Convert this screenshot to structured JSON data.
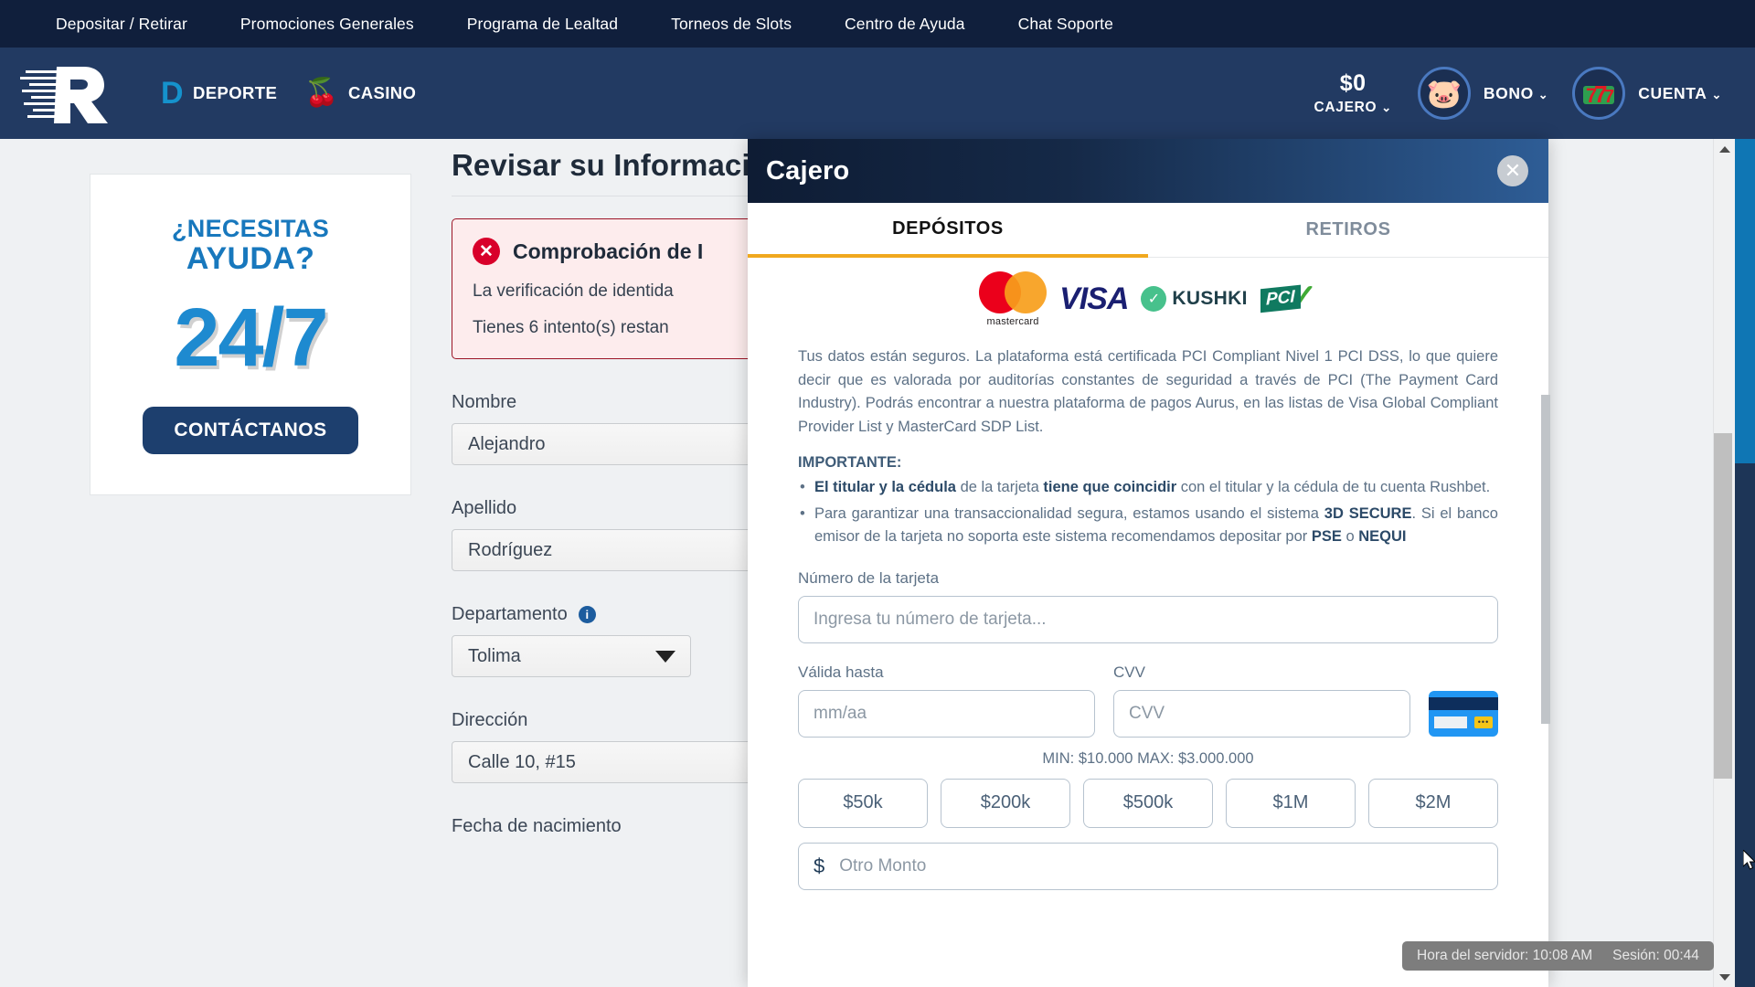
{
  "topnav": {
    "items": [
      {
        "label": "Depositar / Retirar"
      },
      {
        "label": "Promociones Generales"
      },
      {
        "label": "Programa de Lealtad"
      },
      {
        "label": "Torneos de Slots"
      },
      {
        "label": "Centro de Ayuda"
      },
      {
        "label": "Chat Soporte"
      }
    ]
  },
  "header": {
    "brand_logo": "rushbet-r-logo",
    "deporte": {
      "label": "DEPORTE",
      "badge": "D",
      "icon": "deporte-d-icon"
    },
    "casino": {
      "label": "CASINO",
      "icon": "cherries-icon"
    },
    "cajero": {
      "amount": "$0",
      "label": "CAJERO",
      "chevron": "chevron-down-icon"
    },
    "bono": {
      "label": "BONO",
      "icon": "piggy-bank-icon",
      "glyph": "🐷",
      "chevron": "chevron-down-icon"
    },
    "cuenta": {
      "label": "CUENTA",
      "icon": "slot-777-icon",
      "glyph": "7",
      "chevron": "chevron-down-icon"
    }
  },
  "promo": {
    "line1": "¿NECESITAS",
    "line2": "AYUDA?",
    "big": "24/7",
    "button": "CONTÁCTANOS"
  },
  "form": {
    "title": "Revisar su Información",
    "alert": {
      "icon": "error-circle-icon",
      "title": "Comprobación de I",
      "line1": "La verificación de identida",
      "line2": "Tienes 6 intento(s) restan"
    },
    "fields": [
      {
        "label": "Nombre",
        "value": "Alejandro",
        "type": "text"
      },
      {
        "label": "Apellido",
        "value": "Rodríguez",
        "type": "text"
      },
      {
        "label": "Departamento",
        "value": "Tolima",
        "type": "select",
        "info": "i"
      },
      {
        "label": "Dirección",
        "value": "Calle 10, #15",
        "type": "text"
      },
      {
        "label": "Fecha de nacimiento",
        "value": "",
        "type": "text"
      }
    ]
  },
  "modal": {
    "title": "Cajero",
    "close_icon": "close-icon",
    "tabs": [
      {
        "label": "DEPÓSITOS",
        "active": true
      },
      {
        "label": "RETIROS",
        "active": false
      }
    ],
    "logos": [
      {
        "name": "mastercard-logo",
        "text": "mastercard"
      },
      {
        "name": "visa-logo",
        "text": "VISA"
      },
      {
        "name": "kushki-logo",
        "text": "KUSHKI"
      },
      {
        "name": "pci-logo",
        "text": "PCI"
      }
    ],
    "paragraph": "Tus datos están seguros. La plataforma está certificada PCI Compliant Nivel 1 PCI DSS, lo que quiere decir que es valorada por auditorías constantes de seguridad a través de PCI (The Payment Card Industry). Podrás encontrar a nuestra plataforma de pagos Aurus, en las listas de Visa Global Compliant Provider List y MasterCard SDP List.",
    "important_label": "IMPORTANTE:",
    "bullet1": {
      "b1": "El titular y la cédula",
      "t1": " de la tarjeta ",
      "b2": "tiene que coincidir",
      "t2": " con el titular y la cédula de tu cuenta Rushbet."
    },
    "bullet2": {
      "t1": "Para garantizar una transaccionalidad segura, estamos usando el sistema ",
      "b1": "3D SECURE",
      "t2": ". Si el banco emisor de la tarjeta no soporta este sistema recomendamos depositar por ",
      "b2": "PSE",
      "t3": " o ",
      "b3": "NEQUI"
    },
    "card_number": {
      "label": "Número de la tarjeta",
      "placeholder": "Ingresa tu número de tarjeta..."
    },
    "expiry": {
      "label": "Válida hasta",
      "placeholder": "mm/aa"
    },
    "cvv": {
      "label": "CVV",
      "placeholder": "CVV",
      "icon": "credit-card-icon"
    },
    "minmax": "MIN: $10.000 MAX: $3.000.000",
    "amount_buttons": [
      "$50k",
      "$200k",
      "$500k",
      "$1M",
      "$2M"
    ],
    "other_amount": {
      "currency": "$",
      "placeholder": "Otro Monto"
    }
  },
  "status": {
    "server_time": "Hora del servidor: 10:08 AM",
    "session": "Sesión: 00:44"
  },
  "colors": {
    "topnav_bg": "#101f3c",
    "brand_bg": "#223a62",
    "accent_orange": "#f0a81e",
    "accent_blue": "#1592cc",
    "alert_red": "#9c1426"
  }
}
